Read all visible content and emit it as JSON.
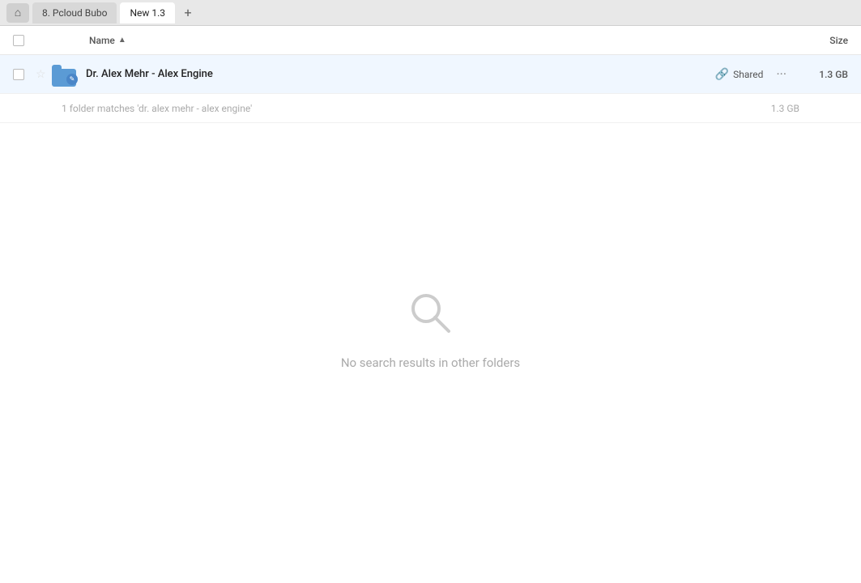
{
  "tabBar": {
    "homeIcon": "🏠",
    "tabs": [
      {
        "label": "8. Pcloud Bubo",
        "active": false
      },
      {
        "label": "New 1.3",
        "active": true
      }
    ],
    "addTabIcon": "+"
  },
  "columnHeaders": {
    "nameLabel": "Name",
    "sizeLabel": "Size",
    "sortIcon": "▲"
  },
  "fileRow": {
    "folderName": "Dr. Alex Mehr - Alex Engine",
    "sharedLabel": "Shared",
    "moreIcon": "···",
    "size": "1.3 GB",
    "starIcon": "★"
  },
  "matchInfo": {
    "text": "1 folder matches 'dr. alex mehr - alex engine'",
    "size": "1.3 GB"
  },
  "emptyState": {
    "message": "No search results in other folders"
  }
}
